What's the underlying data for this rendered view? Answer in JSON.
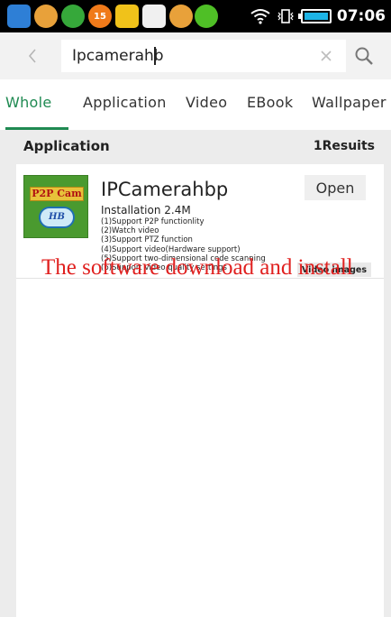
{
  "status_bar": {
    "time": "07:06",
    "notification_icons": [
      {
        "name": "app-notification-icon",
        "color": "#2e7fd6"
      },
      {
        "name": "app-notification-icon",
        "color": "#e8a13a"
      },
      {
        "name": "upload-notification-icon",
        "color": "#36a83a"
      },
      {
        "name": "counter-notification-icon",
        "color": "#f07a1a"
      },
      {
        "name": "app-notification-icon",
        "color": "#f0c21a"
      },
      {
        "name": "app-notification-icon",
        "color": "#f0f0f0"
      },
      {
        "name": "app-notification-icon",
        "color": "#e8a13a"
      },
      {
        "name": "add-notification-icon",
        "color": "#4fbf26"
      }
    ],
    "counter_badge": "15",
    "accent_color": "#1db4e6"
  },
  "search": {
    "query": "Ipcamerahb",
    "back_icon": "chevron-left-icon",
    "clear_icon": "close-icon",
    "submit_icon": "search-icon"
  },
  "tabs": [
    {
      "label": "Whole",
      "active": true
    },
    {
      "label": "Application",
      "active": false
    },
    {
      "label": "Video",
      "active": false
    },
    {
      "label": "EBook",
      "active": false
    },
    {
      "label": "Wallpaper",
      "active": false
    }
  ],
  "theme": {
    "accent": "#1f8a52",
    "overlay_text_color": "#e0201f"
  },
  "results": {
    "section_title": "Application",
    "count_label": "1Resuits",
    "items": [
      {
        "name": "IPCamerahbp",
        "icon_banner": "P2P Cam",
        "icon_badge": "HB",
        "install_info": "Installation 2.4M",
        "features": [
          "(1)Support  P2P functionlity",
          "(2)Watch video",
          "(3)Support  PTZ function",
          "(4)Support video(Hardware support)",
          "(5)Support two-dimensional code scanning",
          "(6)Support video quality settings"
        ],
        "open_label": "Open",
        "video_label": "Video images"
      }
    ]
  },
  "overlay_caption": "The software download and install"
}
